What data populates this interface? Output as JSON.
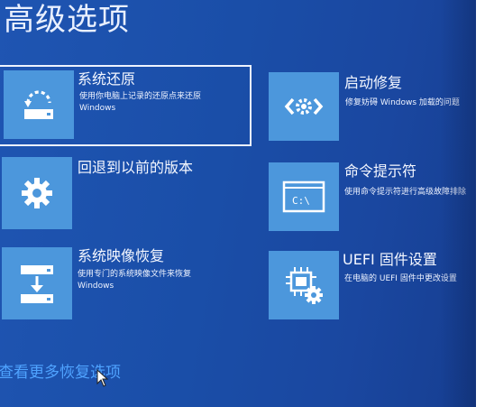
{
  "page": {
    "title": "高级选项",
    "more_link": "查看更多恢复选项"
  },
  "options": [
    {
      "title": "系统还原",
      "desc1": "使用你电脑上记录的还原点来还原",
      "desc2": "Windows",
      "icon": "system-restore-icon",
      "selected": true
    },
    {
      "title": "启动修复",
      "desc1": "修复妨碍 Windows 加载的问题",
      "desc2": "",
      "icon": "startup-repair-icon",
      "selected": false
    },
    {
      "title": "回退到以前的版本",
      "desc1": "",
      "desc2": "",
      "icon": "gear-icon",
      "selected": false
    },
    {
      "title": "命令提示符",
      "desc1": "使用命令提示符进行高级故障排除",
      "desc2": "",
      "icon": "command-prompt-icon",
      "selected": false
    },
    {
      "title": "系统映像恢复",
      "desc1": "使用专门的系统映像文件来恢复",
      "desc2": "Windows",
      "icon": "system-image-recovery-icon",
      "selected": false
    },
    {
      "title": "UEFI 固件设置",
      "desc1": "在电脑的 UEFI 固件中更改设置",
      "desc2": "",
      "icon": "uefi-firmware-icon",
      "selected": false
    }
  ],
  "colors": {
    "background": "#1a4ea8",
    "tile": "#4c97dc",
    "text": "#f4f7ff",
    "link": "#4fa3ff"
  }
}
